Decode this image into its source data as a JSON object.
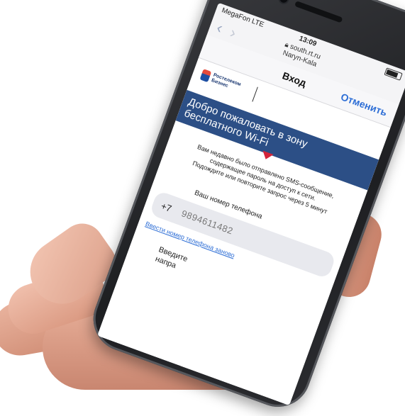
{
  "status": {
    "carrier": "MegaFon LTE",
    "time": "13:09"
  },
  "browser": {
    "url_line1": "south.rt.ru",
    "url_line2": "Naryn-Kala",
    "back_icon": "chevron-left-icon",
    "forward_icon": "chevron-right-icon"
  },
  "nav": {
    "title": "Вход",
    "cancel_label": "Отменить"
  },
  "logo": {
    "line1": "Ростелеком",
    "line2": "Бизнес"
  },
  "banner": {
    "line1": "Добро пожаловать в зону",
    "line2": "бесплатного Wi-Fi"
  },
  "sms_notice": {
    "line1": "Вам недавно было отправлено SMS-сообщение,",
    "line2": "содержащее пароль на доступ к сети.",
    "line3": "Подождите или повторите запрос через 5 минут"
  },
  "form": {
    "phone_label": "Ваш номер телефона",
    "country_code": "+7",
    "phone_value": "9894611482",
    "other_number_link": "Ввести номер телефона заново",
    "enter_line1": "Введите",
    "enter_line2": "напра"
  },
  "colors": {
    "brand_blue": "#2c4f86",
    "link_blue": "#2f6fd6",
    "accent_red": "#d4233a"
  }
}
